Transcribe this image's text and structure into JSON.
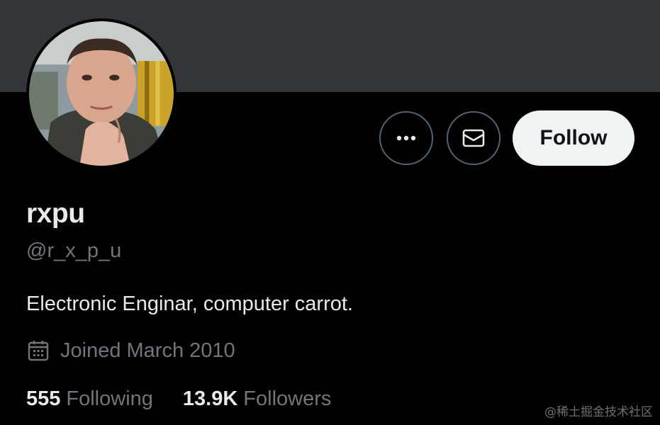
{
  "profile": {
    "display_name": "rxpu",
    "handle": "@r_x_p_u",
    "bio": "Electronic Enginar, computer carrot.",
    "joined": "Joined March 2010"
  },
  "stats": {
    "following_count": "555",
    "following_label": "Following",
    "followers_count": "13.9K",
    "followers_label": "Followers"
  },
  "actions": {
    "follow_label": "Follow",
    "more_icon": "more-icon",
    "message_icon": "envelope-icon"
  },
  "colors": {
    "background": "#000000",
    "banner": "#333639",
    "primary_text": "#e7e9ea",
    "secondary_text": "#71767b",
    "follow_button_bg": "#eff3f4"
  },
  "watermark": "@稀土掘金技术社区"
}
